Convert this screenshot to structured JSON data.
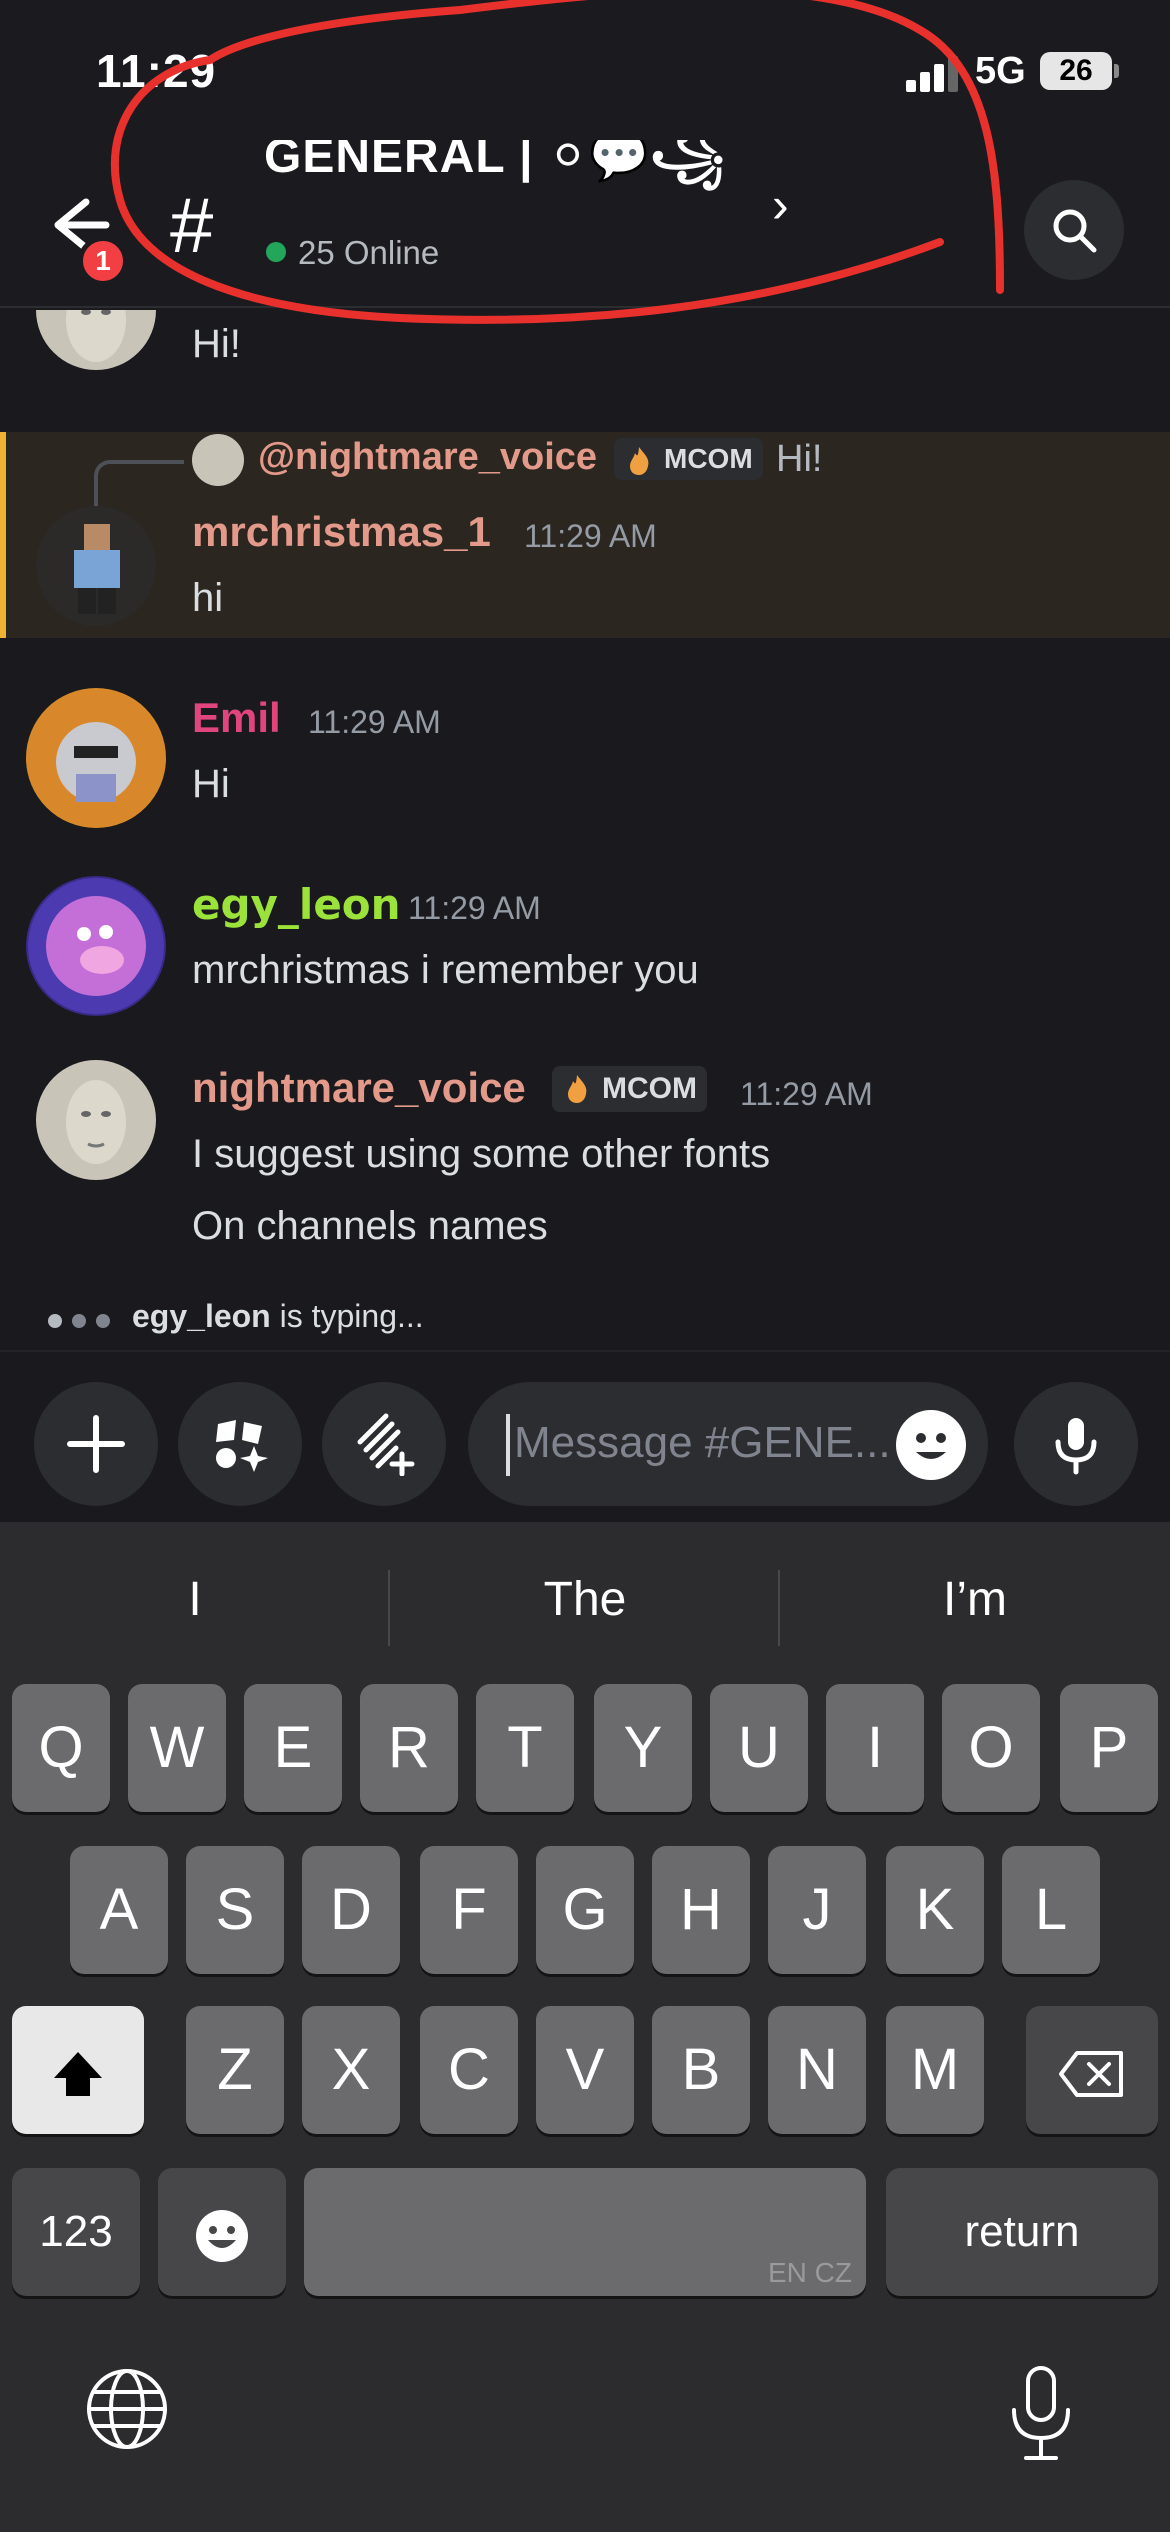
{
  "status_bar": {
    "time": "11:29",
    "network": "5G",
    "battery": "26"
  },
  "header": {
    "back_badge": "1",
    "channel_name": "GENERAL | ⚪💬꧁",
    "online_count": "25 Online"
  },
  "messages": [
    {
      "text": "Hi!"
    },
    {
      "reply": {
        "user": "@nightmare_voice",
        "tag": "MCOM",
        "text": "Hi!"
      },
      "user": "mrchristmas_1",
      "time": "11:29 AM",
      "text": "hi",
      "color": "#e39a8a"
    },
    {
      "user": "Emil",
      "time": "11:29 AM",
      "text": "Hi",
      "color": "#e0457b"
    },
    {
      "user": "egy_leon",
      "time": "11:29 AM",
      "text": "mrchristmas i remember you",
      "color": "#9be23a"
    },
    {
      "user": "nightmare_voice",
      "tag": "MCOM",
      "time": "11:29 AM",
      "lines": [
        "I suggest using some other fonts",
        "On channels names"
      ],
      "color": "#e39a8a"
    }
  ],
  "typing": {
    "user": "egy_leon",
    "suffix": " is typing..."
  },
  "composer": {
    "placeholder": "Message #GENE..."
  },
  "keyboard": {
    "suggestions": [
      "I",
      "The",
      "I’m"
    ],
    "row1": [
      "Q",
      "W",
      "E",
      "R",
      "T",
      "Y",
      "U",
      "I",
      "O",
      "P"
    ],
    "row2": [
      "A",
      "S",
      "D",
      "F",
      "G",
      "H",
      "J",
      "K",
      "L"
    ],
    "row3": [
      "Z",
      "X",
      "C",
      "V",
      "B",
      "N",
      "M"
    ],
    "numbers_label": "123",
    "return_label": "return",
    "space_lang": "EN CZ"
  },
  "colors": {
    "background": "#1a1a1e",
    "accent_highlight": "#f0b232",
    "online": "#23a55a",
    "annotation": "#e8312d"
  },
  "icons": [
    "back-arrow-icon",
    "hash-icon",
    "search-icon",
    "plus-icon",
    "apps-icon",
    "gift-icon",
    "emoji-icon",
    "mic-icon",
    "shift-icon",
    "backspace-icon",
    "globe-icon",
    "dictation-icon"
  ]
}
